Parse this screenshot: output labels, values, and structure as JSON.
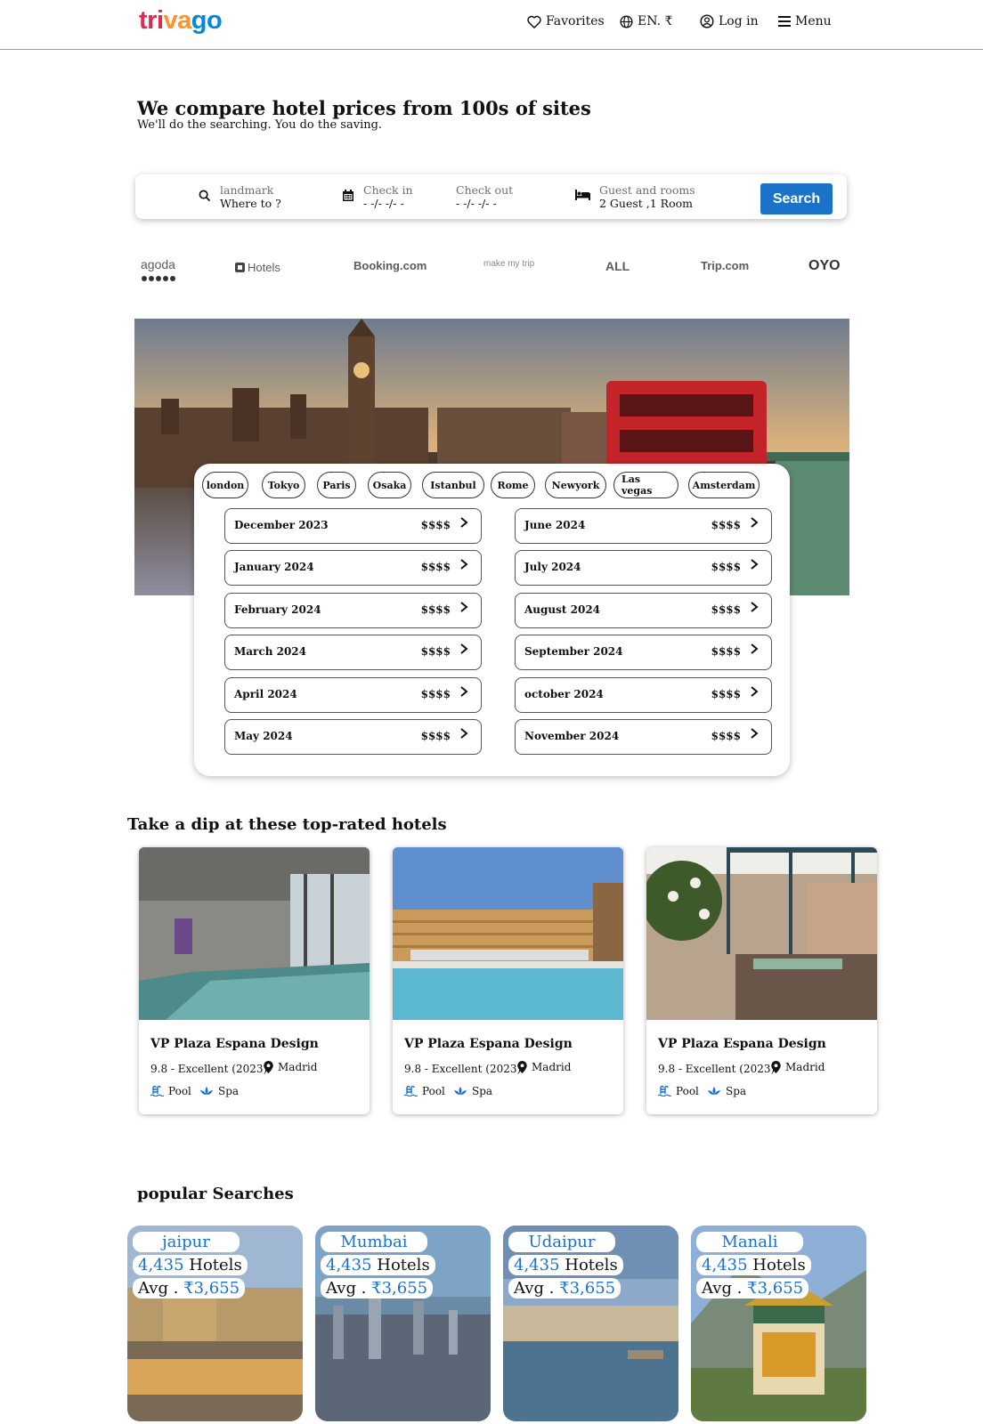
{
  "header": {
    "logo": {
      "part1": "tri",
      "part2": "va",
      "part3": "go"
    },
    "nav": {
      "favorites": "Favorites",
      "language": "EN. ₹",
      "login": "Log in",
      "menu": "Menu"
    }
  },
  "hero": {
    "title": "We compare hotel prices from 100s of sites",
    "subtitle": "We'll do the searching. You do the saving."
  },
  "search": {
    "landmark_label": "landmark",
    "landmark_value": "Where to ?",
    "checkin_label": "Check in",
    "checkin_value": "- -/- -/- -",
    "checkout_label": "Check out",
    "checkout_value": "- -/- -/- -",
    "guests_label": "Guest and rooms",
    "guests_value": "2 Guest ,1 Room",
    "button": "Search"
  },
  "partners": [
    "agoda",
    "Hotels",
    "Booking.com",
    "make my trip",
    "ALL",
    "Trip.com",
    "OYO"
  ],
  "cities": [
    "london",
    "Tokyo",
    "Paris",
    "Osaka",
    "Istanbul",
    "Rome",
    "Newyork",
    "Las vegas",
    "Amsterdam"
  ],
  "months_left": [
    {
      "name": "December 2023",
      "price": "$$$$"
    },
    {
      "name": "January 2024",
      "price": "$$$$"
    },
    {
      "name": "February 2024",
      "price": "$$$$"
    },
    {
      "name": "March 2024",
      "price": "$$$$"
    },
    {
      "name": "April 2024",
      "price": "$$$$"
    },
    {
      "name": "May 2024",
      "price": "$$$$"
    }
  ],
  "months_right": [
    {
      "name": "June 2024",
      "price": "$$$$"
    },
    {
      "name": "July 2024",
      "price": "$$$$"
    },
    {
      "name": "August 2024",
      "price": "$$$$"
    },
    {
      "name": "September 2024",
      "price": "$$$$"
    },
    {
      "name": "october 2024",
      "price": "$$$$"
    },
    {
      "name": "November 2024",
      "price": "$$$$"
    }
  ],
  "arrow_glyph": ">",
  "hotels_section": {
    "title": "Take a dip at these top-rated hotels",
    "hotels": [
      {
        "name": "VP Plaza Espana Design",
        "rating": "9.8 - Excellent (2023)",
        "location": "Madrid",
        "amenity1": "Pool",
        "amenity2": "Spa"
      },
      {
        "name": "VP Plaza Espana Design",
        "rating": "9.8 - Excellent (2023)",
        "location": "Madrid",
        "amenity1": "Pool",
        "amenity2": "Spa"
      },
      {
        "name": "VP Plaza Espana Design",
        "rating": "9.8 - Excellent (2023)",
        "location": "Madrid",
        "amenity1": "Pool",
        "amenity2": "Spa"
      }
    ]
  },
  "popular": {
    "title": "popular Searches",
    "items": [
      {
        "city": "jaipur",
        "count": "4,435",
        "hotels_word": "Hotels",
        "avg_word": "Avg .",
        "avg_price": "₹3,655"
      },
      {
        "city": "Mumbai",
        "count": "4,435",
        "hotels_word": "Hotels",
        "avg_word": "Avg .",
        "avg_price": "₹3,655"
      },
      {
        "city": "Udaipur",
        "count": "4,435",
        "hotels_word": "Hotels",
        "avg_word": "Avg .",
        "avg_price": "₹3,655"
      },
      {
        "city": "Manali",
        "count": "4,435",
        "hotels_word": "Hotels",
        "avg_word": "Avg .",
        "avg_price": "₹3,655"
      }
    ]
  },
  "colors": {
    "accent": "#1a73c8",
    "logo_red": "#e32851",
    "logo_orange": "#ff932c",
    "logo_blue": "#0088d9",
    "link_blue": "#1a6fd0"
  }
}
